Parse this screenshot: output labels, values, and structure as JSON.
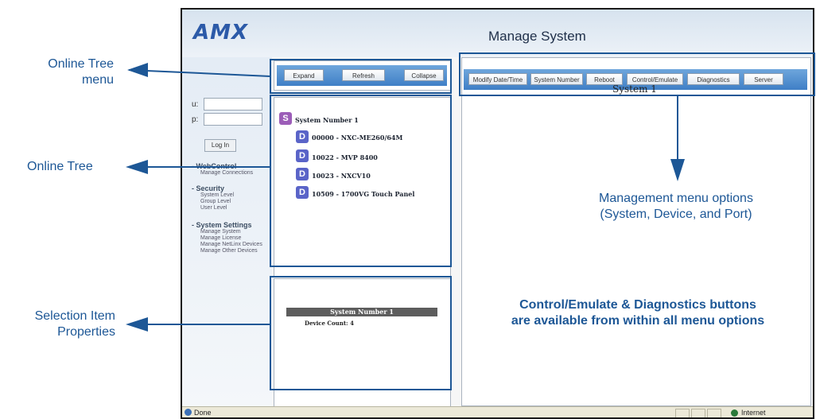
{
  "callouts": {
    "online_tree_menu": [
      "Online Tree",
      "menu"
    ],
    "online_tree": "Online Tree",
    "selection_item_properties": [
      "Selection Item",
      "Properties"
    ],
    "management_menu": [
      "Management menu options",
      "(System, Device, and Port)"
    ],
    "control_note": [
      "Control/Emulate & Diagnostics buttons",
      "are available from within all menu options"
    ],
    "color": "#1d5796"
  },
  "app": {
    "logo": "AMX",
    "title": "Manage System"
  },
  "login": {
    "user_label": "u:",
    "pass_label": "p:",
    "button": "Log In"
  },
  "sidebar": {
    "sections": [
      {
        "heading": "- WebControl",
        "items": [
          "Manage Connections"
        ]
      },
      {
        "heading": "- Security",
        "items": [
          "System Level",
          "Group Level",
          "User Level"
        ]
      },
      {
        "heading": "- System Settings",
        "items": [
          "Manage System",
          "Manage License",
          "Manage NetLinx Devices",
          "Manage Other Devices"
        ]
      }
    ]
  },
  "tree_menu": {
    "buttons": [
      "Expand",
      "Refresh",
      "Collapse"
    ]
  },
  "tree": {
    "root": {
      "icon": "S",
      "label": "System Number 1"
    },
    "devices": [
      {
        "icon": "D",
        "label": "00000 - NXC-ME260/64M"
      },
      {
        "icon": "D",
        "label": "10022 - MVP 8400"
      },
      {
        "icon": "D",
        "label": "10023 - NXCV10"
      },
      {
        "icon": "D",
        "label": "10509 - 1700VG Touch Panel"
      }
    ]
  },
  "management_menu": {
    "buttons": [
      "Modify Date/Time",
      "System Number",
      "Reboot",
      "Control/Emulate",
      "Diagnostics",
      "Server"
    ],
    "system_label": "System 1"
  },
  "properties": {
    "header": "System Number 1",
    "device_count": "Device Count: 4"
  },
  "statusbar": {
    "status": "Done",
    "zone": "Internet"
  }
}
